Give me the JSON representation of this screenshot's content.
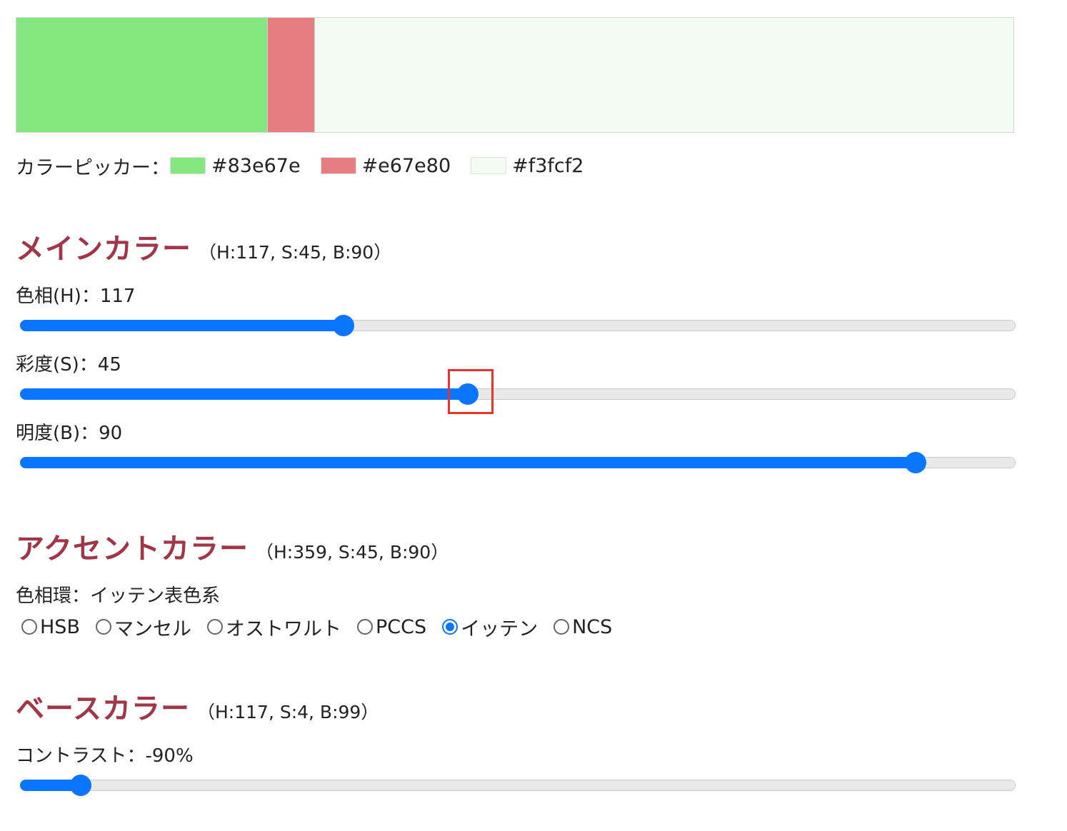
{
  "colors": {
    "main": "#83e67e",
    "accent": "#e67e80",
    "base": "#f3fcf2",
    "slider_accent": "#0a75ff",
    "title_color": "#a03648"
  },
  "picker": {
    "label": "カラーピッカー：",
    "swatches": [
      {
        "hex": "#83e67e"
      },
      {
        "hex": "#e67e80"
      },
      {
        "hex": "#f3fcf2"
      }
    ]
  },
  "main_color": {
    "title": "メインカラー",
    "hsb": "（H:117, S:45, B:90）",
    "hue_label": "色相(H)：117",
    "saturation_label": "彩度(S)：45",
    "brightness_label": "明度(B)：90",
    "hue_value": 117,
    "hue_max": 360,
    "saturation_value": 45,
    "saturation_max": 100,
    "brightness_value": 90,
    "brightness_max": 100
  },
  "accent_color": {
    "title": "アクセントカラー",
    "hsb": "（H:359, S:45, B:90）",
    "wheel_label": "色相環：イッテン表色系",
    "options": [
      {
        "label": "HSB",
        "checked": false
      },
      {
        "label": "マンセル",
        "checked": false
      },
      {
        "label": "オストワルト",
        "checked": false
      },
      {
        "label": "PCCS",
        "checked": false
      },
      {
        "label": "イッテン",
        "checked": true
      },
      {
        "label": "NCS",
        "checked": false
      }
    ]
  },
  "base_color": {
    "title": "ベースカラー",
    "hsb": "（H:117, S:4, B:99）",
    "contrast_label": "コントラスト：-90%",
    "contrast_fraction": 0.06
  }
}
